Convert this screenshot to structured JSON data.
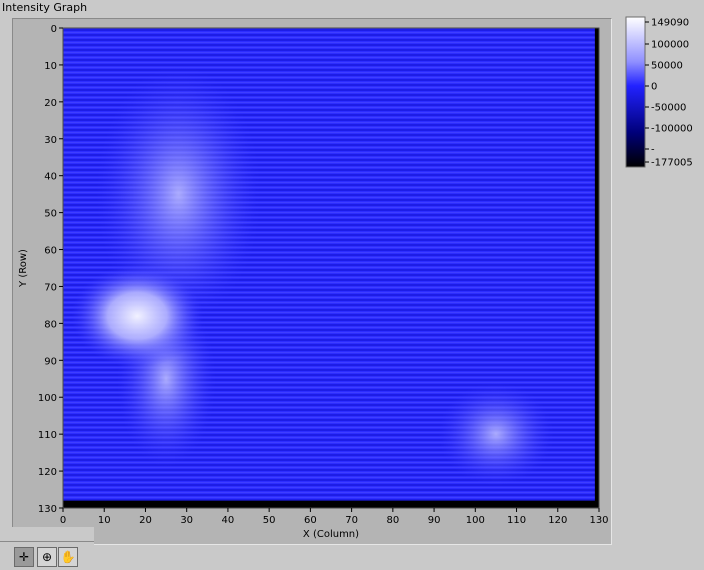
{
  "window": {
    "title": "Intensity Graph"
  },
  "graph": {
    "x_label": "X (Column)",
    "y_label": "Y (Row)"
  },
  "colorbar": {
    "ticks": [
      "149090",
      "100000",
      "50000",
      "0",
      "-50000",
      "-100000",
      "-",
      "-177005"
    ],
    "colors": [
      "#ffffff",
      "#8f8fff",
      "#2222ff",
      "#00007a",
      "#000000"
    ]
  },
  "palette": {
    "tools": [
      {
        "name": "cursor-tool",
        "glyph": "✛"
      },
      {
        "name": "zoom-tool",
        "glyph": "⊕"
      },
      {
        "name": "pan-tool",
        "glyph": "✋"
      }
    ]
  },
  "chart_data": {
    "type": "heatmap",
    "xlabel": "X (Column)",
    "ylabel": "Y (Row)",
    "xlim": [
      0,
      130
    ],
    "ylim": [
      0,
      130
    ],
    "x_ticks": [
      0,
      10,
      20,
      30,
      40,
      50,
      60,
      70,
      80,
      90,
      100,
      110,
      120,
      130
    ],
    "y_ticks": [
      0,
      10,
      20,
      30,
      40,
      50,
      60,
      70,
      80,
      90,
      100,
      110,
      120,
      130
    ],
    "zlim": [
      -177005,
      149090
    ],
    "colorscale": [
      {
        "value": 149090,
        "color": "#ffffff"
      },
      {
        "value": 50000,
        "color": "#8f8fff"
      },
      {
        "value": 0,
        "color": "#2222ff"
      },
      {
        "value": -100000,
        "color": "#00007a"
      },
      {
        "value": -177005,
        "color": "#000000"
      }
    ],
    "grid": false,
    "region_values": [
      {
        "region": "background",
        "value": 5000
      },
      {
        "region": "bright-spot",
        "x": 18,
        "y": 78,
        "value": 120000
      },
      {
        "region": "bright-band",
        "x": 25,
        "y": 95,
        "value": 70000
      },
      {
        "region": "bright-ridge",
        "x": 28,
        "y": 45,
        "value": 55000
      },
      {
        "region": "bright-lower-right",
        "x": 105,
        "y": 110,
        "value": 50000
      },
      {
        "region": "dark-strip-bottom",
        "y": 128,
        "value": -177005
      },
      {
        "region": "dark-strip-right",
        "x": 129,
        "value": -177005
      }
    ]
  }
}
